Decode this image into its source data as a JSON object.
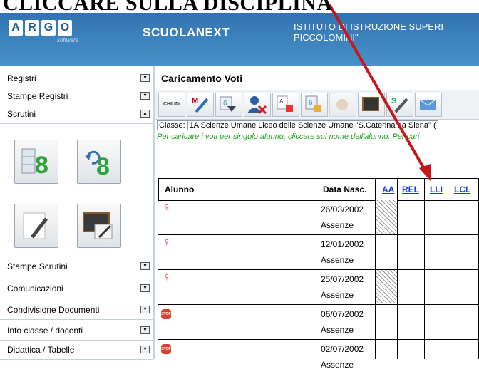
{
  "annotation": {
    "title": "CLICCARE SULLA DISCIPLINA"
  },
  "header": {
    "logo_letters": [
      "A",
      "R",
      "G",
      "O"
    ],
    "logo_sub": "software",
    "app_name": "SCUOLANEXT",
    "school_line1": "ISTITUTO DI ISTRUZIONE SUPERI",
    "school_line2": "PICCOLOMINI\""
  },
  "sidebar": {
    "items_top": [
      {
        "label": "Registri",
        "toggle": "▾"
      },
      {
        "label": "Stampe Registri",
        "toggle": "▾"
      },
      {
        "label": "Scrutini",
        "toggle": "▴"
      }
    ],
    "items_bottom": [
      {
        "label": "Stampe Scrutini",
        "toggle": "▾"
      },
      {
        "label": "Comunicazioni",
        "toggle": "▾"
      },
      {
        "label": "Condivisione Documenti",
        "toggle": "▾"
      },
      {
        "label": "Info classe / docenti",
        "toggle": "▾"
      },
      {
        "label": "Didattica / Tabelle",
        "toggle": "▾"
      }
    ]
  },
  "main": {
    "title": "Caricamento Voti",
    "toolbar": {
      "chiudi": "CHIUDI"
    },
    "classe_label": "Classe:",
    "classe_value": "1A Scienze Umane Liceo delle Scienze Umane \"S.Caterina da Siena\" (",
    "hint": "Per caricare i voti per singolo alunno, cliccare sul nome dell'alunno. Per cari"
  },
  "table": {
    "col_alunno": "Alunno",
    "col_data": "Data Nasc.",
    "subjects": [
      "AA",
      "REL",
      "LLI",
      "LCL"
    ],
    "assenze_label": "Assenze",
    "rows": [
      {
        "date": "26/03/2002",
        "icon": "female-icon"
      },
      {
        "date": "12/01/2002",
        "icon": "female-icon"
      },
      {
        "date": "25/07/2002",
        "icon": "female-icon"
      },
      {
        "date": "06/07/2002",
        "icon": "stop-icon"
      },
      {
        "date": "02/07/2002",
        "icon": "stop-icon"
      }
    ]
  },
  "colors": {
    "header_blue": "#3c7fb8",
    "link_blue": "#1a3bc9",
    "hint_green": "#18a318",
    "arrow_red": "#c8161d"
  }
}
